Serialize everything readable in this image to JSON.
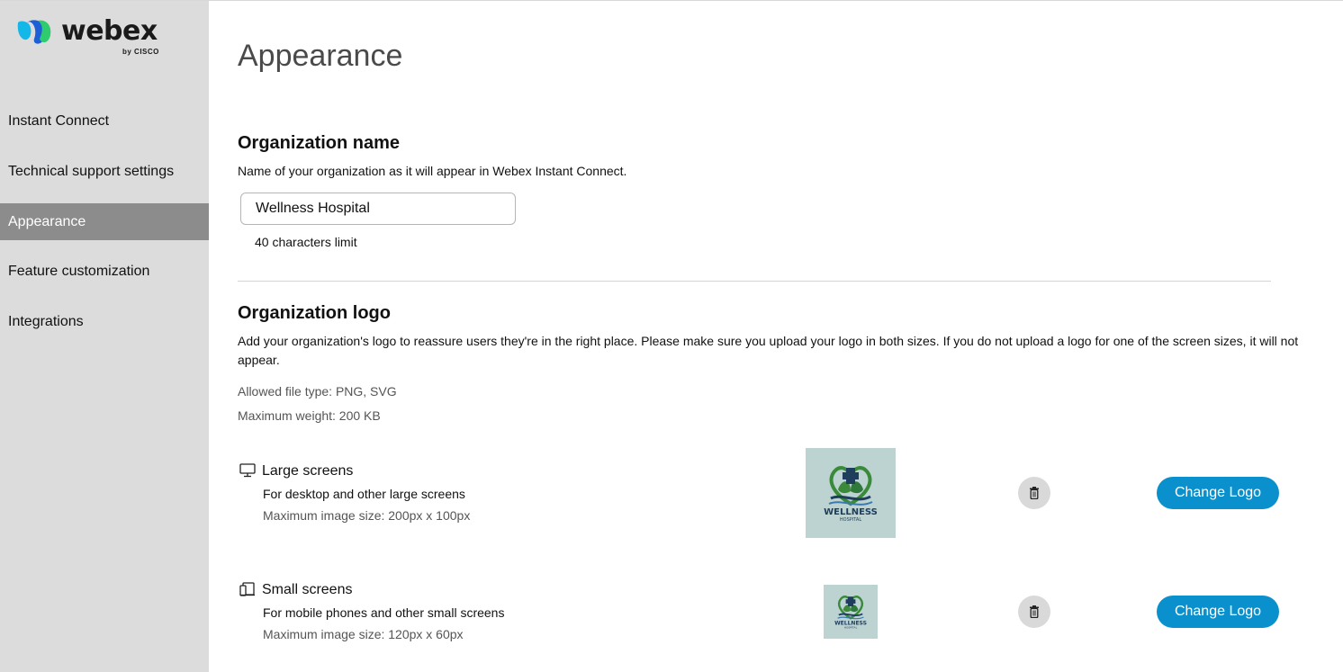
{
  "brand": {
    "name": "webex",
    "by": "by CISCO"
  },
  "sidebar": {
    "items": [
      {
        "label": "Instant Connect"
      },
      {
        "label": "Technical support settings"
      },
      {
        "label": "Appearance"
      },
      {
        "label": "Feature customization"
      },
      {
        "label": "Integrations"
      }
    ],
    "active_index": 2
  },
  "page": {
    "title": "Appearance"
  },
  "org_name": {
    "heading": "Organization name",
    "description": "Name of your organization as it will appear in Webex Instant Connect.",
    "value": "Wellness Hospital",
    "char_limit": "40 characters limit"
  },
  "org_logo": {
    "heading": "Organization logo",
    "description": "Add your organization's logo to reassure users they're in the right place. Please make sure you upload your logo in both sizes. If you do not upload a logo for one of the screen sizes, it will not appear.",
    "allowed_types": "Allowed file type: PNG, SVG",
    "max_weight": "Maximum weight: 200 KB",
    "rows": [
      {
        "icon": "monitor-icon",
        "title": "Large screens",
        "subtitle": "For desktop and other large screens",
        "max_size": "Maximum image size: 200px x 100px",
        "logo_text": "WELLNESS",
        "logo_subtext": "HOSPITAL",
        "button_label": "Change Logo"
      },
      {
        "icon": "devices-icon",
        "title": "Small screens",
        "subtitle": "For mobile phones and other small screens",
        "max_size": "Maximum image size: 120px x 60px",
        "logo_text": "WELLNESS",
        "logo_subtext": "HOSPITAL",
        "button_label": "Change Logo"
      }
    ]
  },
  "colors": {
    "sidebar_bg": "#dcdcdc",
    "active_item": "#8c8c8c",
    "primary_button": "#0a90cc",
    "logo_green": "#3a8a3a",
    "logo_navy": "#1f3d5c"
  }
}
